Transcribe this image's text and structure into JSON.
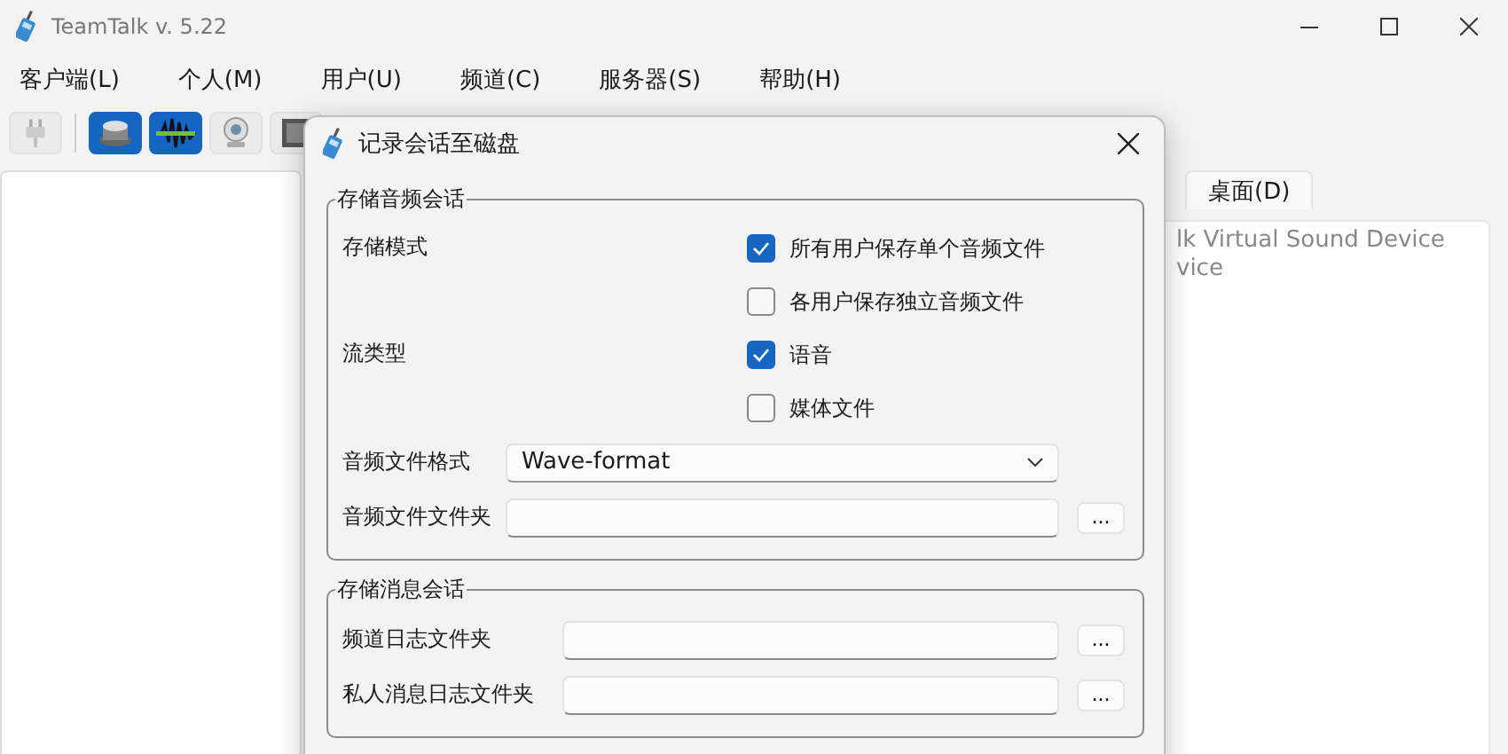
{
  "window": {
    "title": "TeamTalk v. 5.22"
  },
  "menu": [
    "客户端(L)",
    "个人(M)",
    "用户(U)",
    "频道(C)",
    "服务器(S)",
    "帮助(H)"
  ],
  "toolbar": [
    {
      "kind": "plug",
      "selected": false
    },
    {
      "kind": "speaker",
      "selected": true
    },
    {
      "kind": "wave",
      "selected": true
    },
    {
      "kind": "webcam",
      "selected": false
    },
    {
      "kind": "desktop",
      "selected": false
    }
  ],
  "tabs": [
    {
      "label": "桌面(D)",
      "selected": true
    }
  ],
  "device_list": [
    "lk Virtual Sound Device",
    "vice"
  ],
  "dialog": {
    "title": "记录会话至磁盘",
    "audio_group": {
      "legend": "存储音频会话",
      "option_rows": [
        {
          "label": "存储模式",
          "options": [
            {
              "label": "所有用户保存单个音频文件",
              "checked": true
            },
            {
              "label": "各用户保存独立音频文件",
              "checked": false
            }
          ]
        },
        {
          "label": "流类型",
          "options": [
            {
              "label": "语音",
              "checked": true
            },
            {
              "label": "媒体文件",
              "checked": false
            }
          ]
        }
      ],
      "format": {
        "label": "音频文件格式",
        "value": "Wave-format"
      },
      "folder": {
        "label": "音频文件文件夹",
        "button": "..."
      }
    },
    "message_group": {
      "legend": "存储消息会话",
      "folders": [
        {
          "label": "频道日志文件夹",
          "button": "..."
        },
        {
          "label": "私人消息日志文件夹",
          "button": "..."
        }
      ]
    }
  }
}
